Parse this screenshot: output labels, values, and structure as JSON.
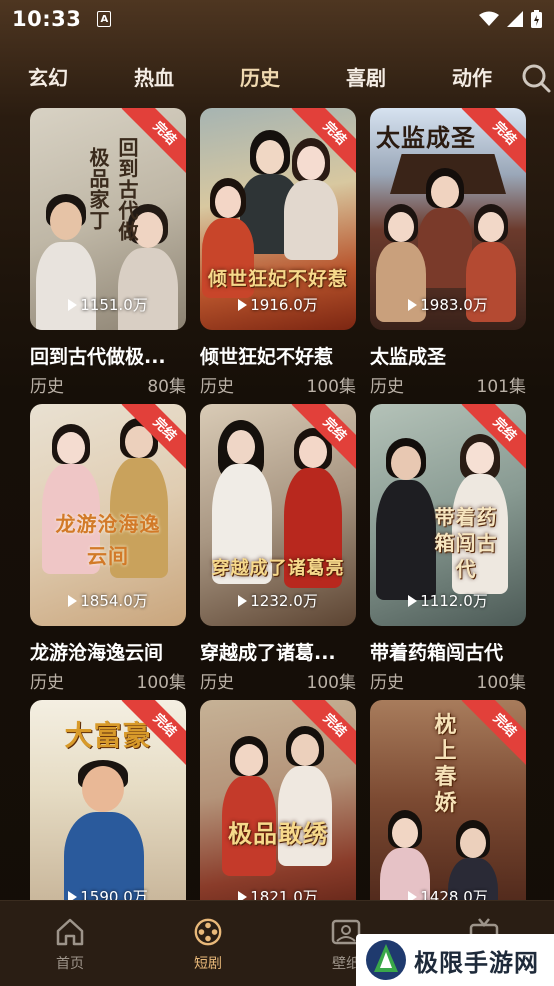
{
  "status_bar": {
    "time": "10:33",
    "notification_letter": "A"
  },
  "tabs": [
    {
      "label": "玄幻",
      "active": false
    },
    {
      "label": "热血",
      "active": false
    },
    {
      "label": "历史",
      "active": true
    },
    {
      "label": "喜剧",
      "active": false
    },
    {
      "label": "动作",
      "active": false
    }
  ],
  "ribbon_label": "完结",
  "cards": [
    {
      "name": "回到古代做极...",
      "genre": "历史",
      "episodes": "80集",
      "views": "1151.0万",
      "poster_text": "回到古代做极品家丁"
    },
    {
      "name": "倾世狂妃不好惹",
      "genre": "历史",
      "episodes": "100集",
      "views": "1916.0万",
      "poster_text": "倾世狂妃不好惹"
    },
    {
      "name": "太监成圣",
      "genre": "历史",
      "episodes": "101集",
      "views": "1983.0万",
      "poster_text": "太监成圣"
    },
    {
      "name": "龙游沧海逸云间",
      "genre": "历史",
      "episodes": "100集",
      "views": "1854.0万",
      "poster_text": "龙游沧海逸云间"
    },
    {
      "name": "穿越成了诸葛...",
      "genre": "历史",
      "episodes": "100集",
      "views": "1232.0万",
      "poster_text": "穿越成了诸葛亮"
    },
    {
      "name": "带着药箱闯古代",
      "genre": "历史",
      "episodes": "100集",
      "views": "1112.0万",
      "poster_text": "带着药箱闯古代"
    },
    {
      "name": "",
      "genre": "",
      "episodes": "",
      "views": "1590.0万",
      "poster_text": "大富豪"
    },
    {
      "name": "",
      "genre": "",
      "episodes": "",
      "views": "1821.0万",
      "poster_text": "极品敢绣"
    },
    {
      "name": "",
      "genre": "",
      "episodes": "",
      "views": "1428.0万",
      "poster_text": "枕上春娇"
    }
  ],
  "bottom_nav": [
    {
      "label": "首页",
      "icon": "home-icon",
      "active": false
    },
    {
      "label": "短剧",
      "icon": "film-reel-icon",
      "active": true
    },
    {
      "label": "壁纸",
      "icon": "image-icon",
      "active": false
    },
    {
      "label": "",
      "icon": "tv-icon",
      "active": false
    }
  ],
  "watermark": {
    "text": "极限手游网"
  },
  "colors": {
    "accent": "#e9b97a",
    "ribbon": "#e2403a",
    "background": "#160f08"
  }
}
